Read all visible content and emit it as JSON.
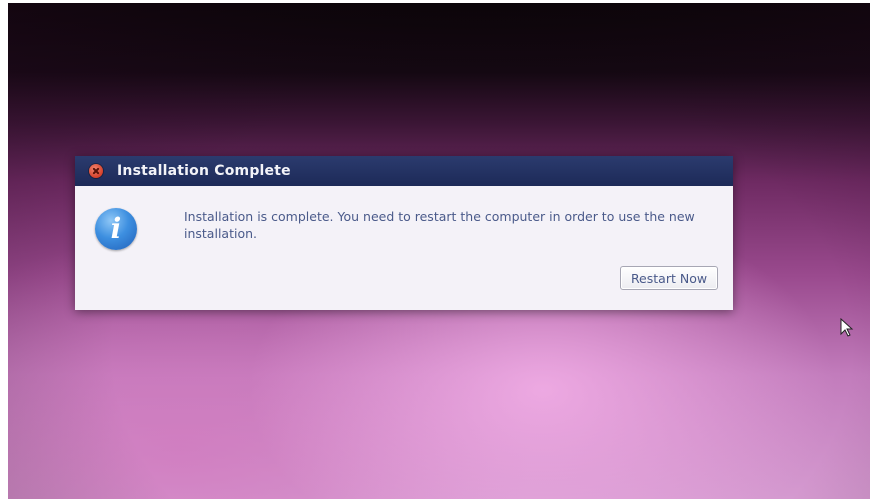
{
  "dialog": {
    "title": "Installation Complete",
    "message": "Installation is complete. You need to restart the computer in order to use the new installation.",
    "restart_label": "Restart Now",
    "icon": "info-icon",
    "close_icon": "close-icon"
  },
  "colors": {
    "titlebar": "#1d2a58",
    "dialog_body": "#f4f2f8",
    "text": "#4a5a8a",
    "close": "#d5402a",
    "info": "#3d8fe0"
  }
}
